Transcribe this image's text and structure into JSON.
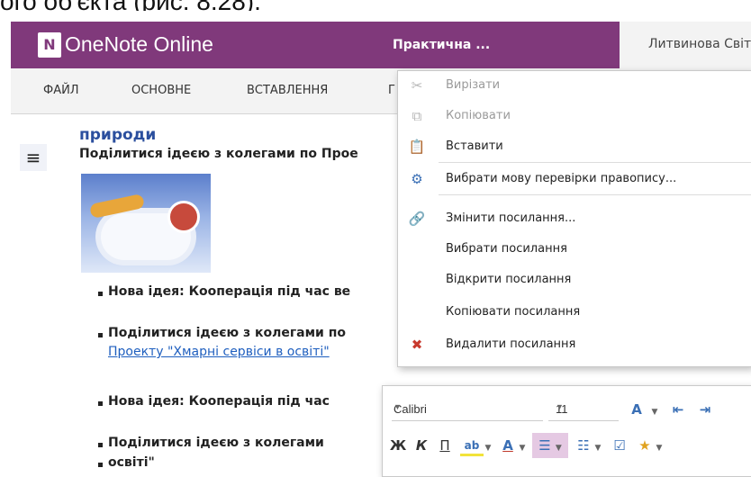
{
  "caption": "ого об'єкта (рис. 8.28).",
  "app": {
    "name": "OneNote Online",
    "logo": "N",
    "notebook": "Практична ...",
    "user": "Литвинова Світ"
  },
  "ribbon": {
    "tabs": [
      "ФАЙЛ",
      "ОСНОВНЕ",
      "ВСТАВЛЕННЯ",
      "Г"
    ]
  },
  "page": {
    "heading": "природи",
    "share_line": "Поділитися ідеєю з колегами по Прое",
    "bullets": [
      {
        "text": "Нова ідея: Кооперація під час ве"
      },
      {
        "text": "Поділитися ідеєю з колегами по",
        "link": "Проекту \"Хмарні сервіси в освіті\""
      },
      {
        "text": "Нова ідея: Кооперація під час"
      },
      {
        "text": "Поділитися ідеєю з колегами",
        "line2": "освіті\""
      }
    ]
  },
  "context_menu": {
    "items": [
      {
        "label": "Вирізати",
        "icon": "scissors-icon",
        "disabled": true
      },
      {
        "label": "Копіювати",
        "icon": "copy-icon",
        "disabled": true
      },
      {
        "label": "Вставити",
        "icon": "paste-icon",
        "disabled": false
      },
      {
        "label": "Вибрати мову перевірки правопису...",
        "icon": "spelling-language-icon",
        "disabled": false
      },
      {
        "label": "Змінити посилання...",
        "icon": "edit-link-icon",
        "disabled": false
      },
      {
        "label": "Вибрати посилання",
        "icon": "",
        "disabled": false
      },
      {
        "label": "Відкрити посилання",
        "icon": "",
        "disabled": false
      },
      {
        "label": "Копіювати посилання",
        "icon": "",
        "disabled": false
      },
      {
        "label": "Видалити посилання",
        "icon": "remove-link-icon",
        "disabled": false
      }
    ]
  },
  "mini_toolbar": {
    "font": "Calibri",
    "size": "11",
    "bold": "Ж",
    "italic": "К",
    "underline": "П",
    "font_color": "А"
  },
  "colors": {
    "accent": "#80397b",
    "link": "#1f5fbf",
    "heading": "#2b4f9e"
  }
}
